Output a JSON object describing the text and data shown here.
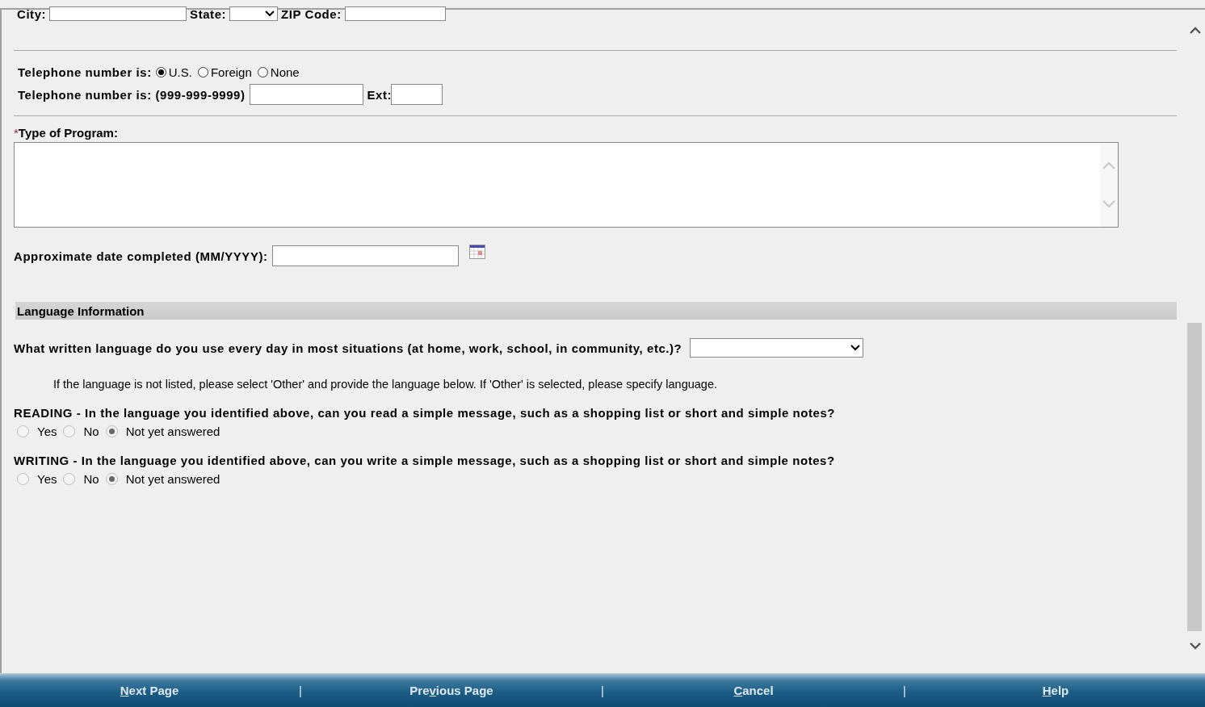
{
  "address": {
    "city_label": "City:",
    "state_label": "State:",
    "zip_label": "ZIP Code:"
  },
  "telephone": {
    "type_label": "Telephone number is:",
    "types": [
      {
        "label": "U.S.",
        "selected": true
      },
      {
        "label": "Foreign",
        "selected": false
      },
      {
        "label": "None",
        "selected": false
      }
    ],
    "number_label": "Telephone number is: (999-999-9999)",
    "ext_label": "Ext:"
  },
  "program": {
    "required_mark": "*",
    "label": "Type of Program:"
  },
  "date": {
    "label": "Approximate date completed (MM/YYYY):"
  },
  "language_section": {
    "title": "Language Information",
    "question": "What written language do you use every day in most situations (at home, work, school, in community, etc.)?",
    "hint": "If the language is not listed, please select 'Other' and provide the language below. If 'Other' is selected, please specify language.",
    "questions": [
      {
        "label": "READING - In the language you identified above, can you read a simple message, such as a shopping list or short and simple notes?",
        "disabled": true,
        "options": [
          {
            "label": "Yes",
            "selected": false
          },
          {
            "label": "No",
            "selected": false
          },
          {
            "label": "Not yet answered",
            "selected": true
          }
        ]
      },
      {
        "label": "WRITING - In the language you identified above, can you write a simple message, such as a shopping list or short and simple notes?",
        "disabled": true,
        "options": [
          {
            "label": "Yes",
            "selected": false
          },
          {
            "label": "No",
            "selected": false
          },
          {
            "label": "Not yet answered",
            "selected": true
          }
        ]
      }
    ]
  },
  "footer_buttons": [
    {
      "key": "N",
      "post": "ext Page"
    },
    {
      "pre": "Pre",
      "key": "v",
      "post": "ious Page"
    },
    {
      "key": "C",
      "post": "ancel"
    },
    {
      "key": "H",
      "post": "elp"
    }
  ],
  "footer_separator": "|"
}
